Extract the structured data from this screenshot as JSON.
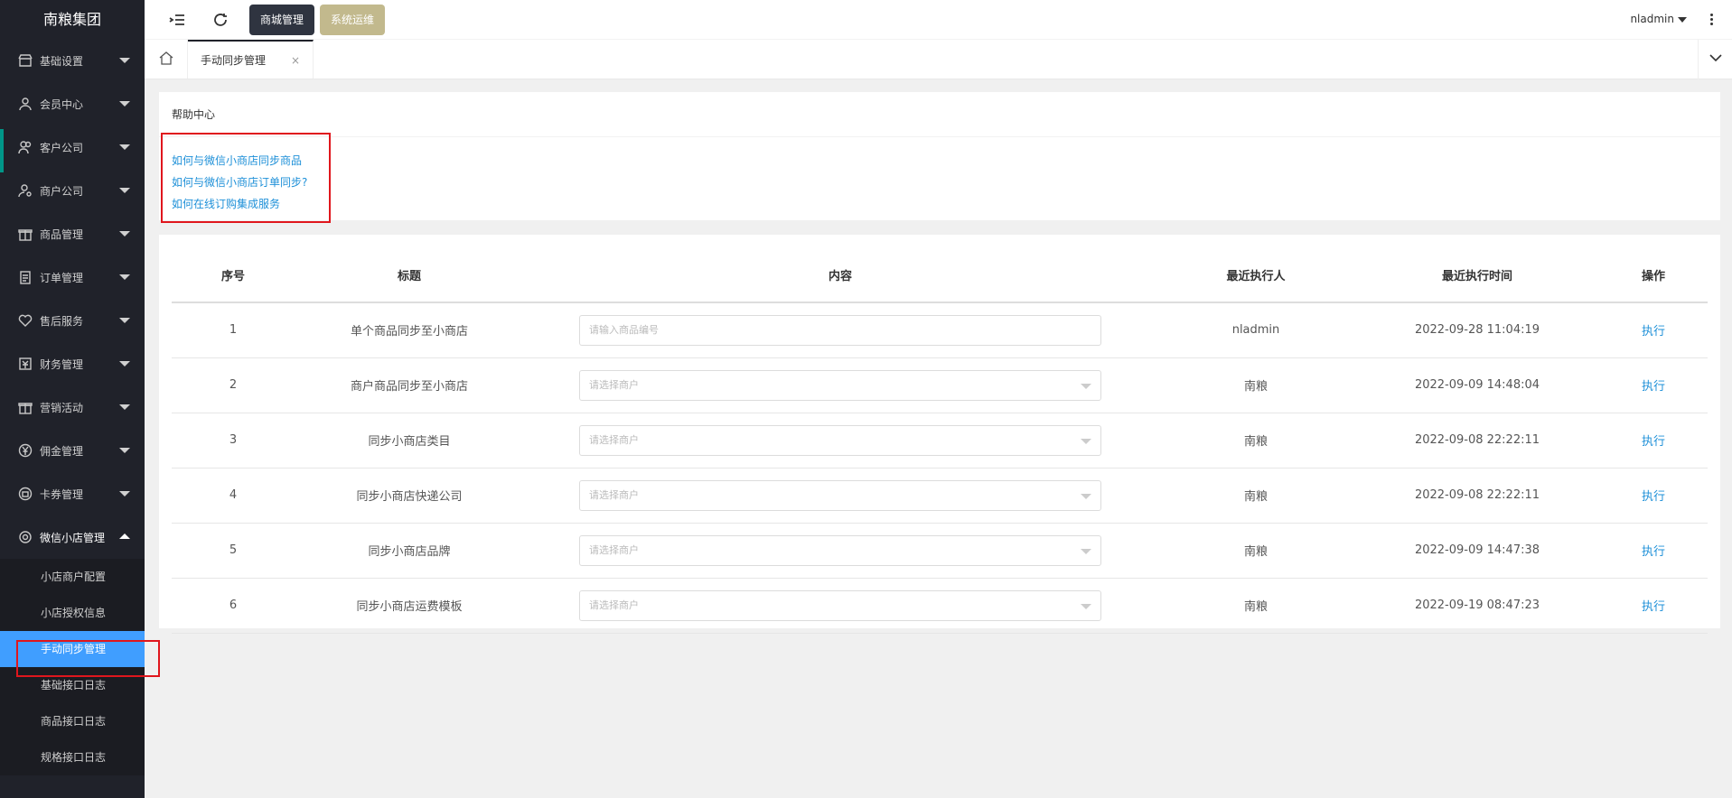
{
  "sidebar": {
    "logo": "南粮集团",
    "items": [
      {
        "label": "基础设置",
        "icon": "store-icon"
      },
      {
        "label": "会员中心",
        "icon": "user-icon"
      },
      {
        "label": "客户公司",
        "icon": "users-icon"
      },
      {
        "label": "商户公司",
        "icon": "user-cog-icon"
      },
      {
        "label": "商品管理",
        "icon": "gift-icon"
      },
      {
        "label": "订单管理",
        "icon": "clipboard-icon"
      },
      {
        "label": "售后服务",
        "icon": "heart-icon"
      },
      {
        "label": "财务管理",
        "icon": "finance-icon"
      },
      {
        "label": "营销活动",
        "icon": "gift-icon"
      },
      {
        "label": "佣金管理",
        "icon": "yen-icon"
      },
      {
        "label": "卡券管理",
        "icon": "card-icon"
      },
      {
        "label": "微信小店管理",
        "icon": "gear-icon"
      }
    ],
    "sub_items": [
      {
        "label": "小店商户配置"
      },
      {
        "label": "小店授权信息"
      },
      {
        "label": "手动同步管理"
      },
      {
        "label": "基础接口日志"
      },
      {
        "label": "商品接口日志"
      },
      {
        "label": "规格接口日志"
      }
    ]
  },
  "topbar": {
    "btn_mall": "商城管理",
    "btn_ops": "系统运维",
    "user": "nladmin"
  },
  "tabs": {
    "current": "手动同步管理",
    "close": "×"
  },
  "help": {
    "title": "帮助中心",
    "links": [
      "如何与微信小商店同步商品",
      "如何与微信小商店订单同步?",
      "如何在线订购集成服务"
    ]
  },
  "table": {
    "headers": [
      "序号",
      "标题",
      "内容",
      "最近执行人",
      "最近执行时间",
      "操作"
    ],
    "rows": [
      {
        "no": "1",
        "title": "单个商品同步至小商店",
        "placeholder": "请输入商品编号",
        "executor": "nladmin",
        "time": "2022-09-28 11:04:19",
        "action": "执行"
      },
      {
        "no": "2",
        "title": "商户商品同步至小商店",
        "placeholder": "请选择商户",
        "executor": "南粮",
        "time": "2022-09-09 14:48:04",
        "action": "执行"
      },
      {
        "no": "3",
        "title": "同步小商店类目",
        "placeholder": "请选择商户",
        "executor": "南粮",
        "time": "2022-09-08 22:22:11",
        "action": "执行"
      },
      {
        "no": "4",
        "title": "同步小商店快递公司",
        "placeholder": "请选择商户",
        "executor": "南粮",
        "time": "2022-09-08 22:22:11",
        "action": "执行"
      },
      {
        "no": "5",
        "title": "同步小商店品牌",
        "placeholder": "请选择商户",
        "executor": "南粮",
        "time": "2022-09-09 14:47:38",
        "action": "执行"
      },
      {
        "no": "6",
        "title": "同步小商店运费模板",
        "placeholder": "请选择商户",
        "executor": "南粮",
        "time": "2022-09-19 08:47:23",
        "action": "执行"
      }
    ]
  }
}
